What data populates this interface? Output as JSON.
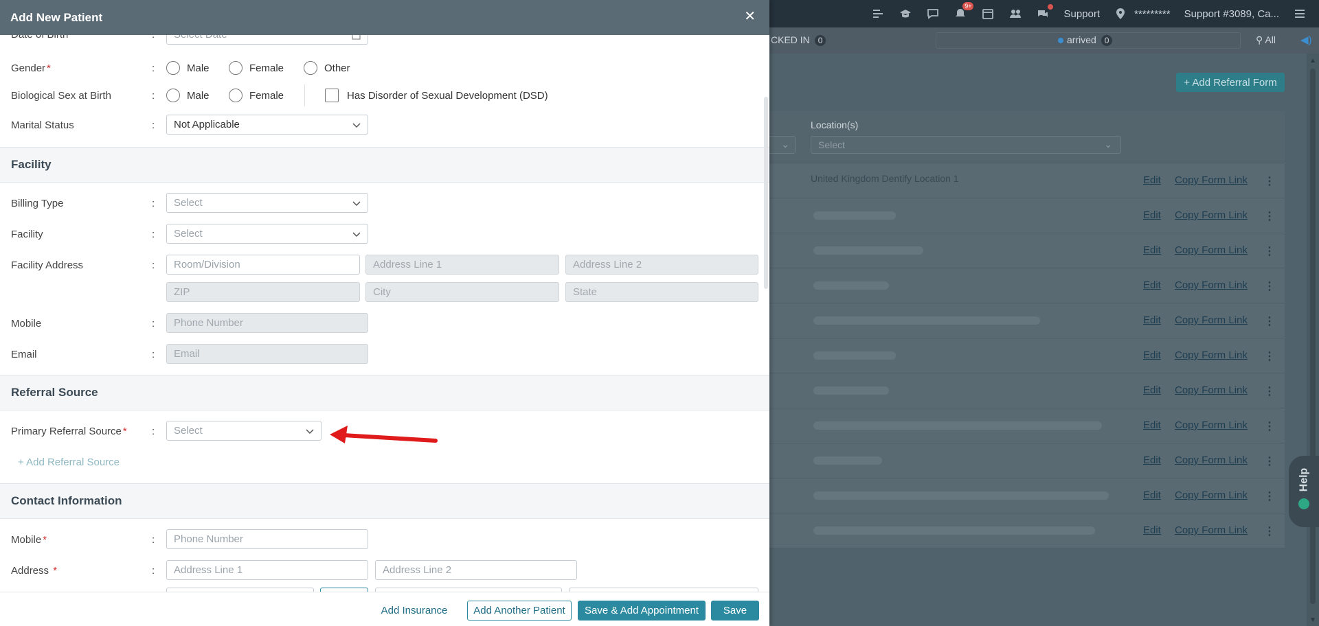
{
  "background": {
    "topbar": {
      "notification_badge": "9+",
      "support_label": "Support",
      "location_mask": "*********",
      "support_ticket": "Support #3089, Ca..."
    },
    "subbar": {
      "checked_in_label": "CKED IN",
      "checked_in_count": "0",
      "arrived_label": "arrived",
      "arrived_count": "0",
      "all_label": "All"
    },
    "add_referral_form_label": "+ Add Referral Form",
    "table": {
      "location_header": "Location(s)",
      "location_placeholder": "Select",
      "first_row_location": "United Kingdom Dentify Location 1",
      "row_edit_label": "Edit",
      "row_copy_label": "Copy Form Link",
      "row_count": 11
    },
    "help_label": "Help"
  },
  "modal": {
    "title": "Add New Patient",
    "demographics": {
      "dob": {
        "label": "Date of Birth",
        "placeholder": "Select Date"
      },
      "gender": {
        "label": "Gender",
        "options": [
          "Male",
          "Female",
          "Other"
        ]
      },
      "bio_sex": {
        "label": "Biological Sex at Birth",
        "options": [
          "Male",
          "Female"
        ],
        "dsd_label": "Has Disorder of Sexual Development (DSD)"
      },
      "marital": {
        "label": "Marital Status",
        "value": "Not Applicable"
      }
    },
    "facility": {
      "heading": "Facility",
      "billing_type": {
        "label": "Billing Type",
        "placeholder": "Select"
      },
      "facility": {
        "label": "Facility",
        "placeholder": "Select"
      },
      "address": {
        "label": "Facility Address",
        "room_placeholder": "Room/Division",
        "line1_placeholder": "Address Line 1",
        "line2_placeholder": "Address Line 2",
        "zip_placeholder": "ZIP",
        "city_placeholder": "City",
        "state_placeholder": "State"
      },
      "mobile": {
        "label": "Mobile",
        "placeholder": "Phone Number"
      },
      "email": {
        "label": "Email",
        "placeholder": "Email"
      }
    },
    "referral": {
      "heading": "Referral Source",
      "primary": {
        "label": "Primary Referral Source",
        "placeholder": "Select"
      },
      "add_label": "+ Add Referral Source"
    },
    "contact": {
      "heading": "Contact Information",
      "mobile": {
        "label": "Mobile",
        "placeholder": "Phone Number"
      },
      "address": {
        "label": "Address",
        "line1_placeholder": "Address Line 1",
        "line2_placeholder": "Address Line 2"
      }
    },
    "footer": {
      "add_insurance": "Add Insurance",
      "add_another": "Add Another Patient",
      "save_add_appt": "Save & Add Appointment",
      "save": "Save"
    }
  },
  "colors": {
    "header_bg": "#5b6b75",
    "primary": "#2b8aa0",
    "required": "#d32f2f",
    "annotation_arrow": "#e01b1b"
  }
}
